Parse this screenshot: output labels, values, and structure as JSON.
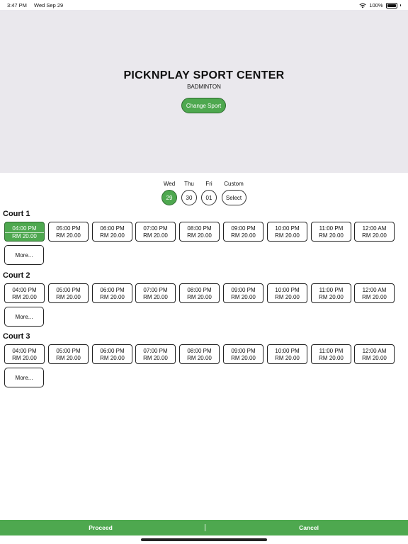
{
  "status_bar": {
    "time": "3:47 PM",
    "date": "Wed Sep 29",
    "battery": "100%",
    "wifi_icon": "wifi-icon",
    "battery_icon": "battery-icon"
  },
  "header": {
    "venue": "PICKNPLAY SPORT CENTER",
    "sport": "BADMINTON",
    "change_sport_label": "Change Sport"
  },
  "days": [
    {
      "label": "Wed",
      "value": "29",
      "selected": true
    },
    {
      "label": "Thu",
      "value": "30",
      "selected": false
    },
    {
      "label": "Fri",
      "value": "01",
      "selected": false
    },
    {
      "label": "Custom",
      "value": "Select",
      "selected": false
    }
  ],
  "courts": [
    {
      "name": "Court 1",
      "more_label": "More...",
      "selected_slot": 0,
      "slots": [
        {
          "time": "04:00 PM",
          "price": "RM 20.00"
        },
        {
          "time": "05:00 PM",
          "price": "RM 20.00"
        },
        {
          "time": "06:00 PM",
          "price": "RM 20.00"
        },
        {
          "time": "07:00 PM",
          "price": "RM 20.00"
        },
        {
          "time": "08:00 PM",
          "price": "RM 20.00"
        },
        {
          "time": "09:00 PM",
          "price": "RM 20.00"
        },
        {
          "time": "10:00 PM",
          "price": "RM 20.00"
        },
        {
          "time": "11:00 PM",
          "price": "RM 20.00"
        },
        {
          "time": "12:00 AM",
          "price": "RM 20.00"
        }
      ]
    },
    {
      "name": "Court 2",
      "more_label": "More...",
      "selected_slot": -1,
      "slots": [
        {
          "time": "04:00 PM",
          "price": "RM 20.00"
        },
        {
          "time": "05:00 PM",
          "price": "RM 20.00"
        },
        {
          "time": "06:00 PM",
          "price": "RM 20.00"
        },
        {
          "time": "07:00 PM",
          "price": "RM 20.00"
        },
        {
          "time": "08:00 PM",
          "price": "RM 20.00"
        },
        {
          "time": "09:00 PM",
          "price": "RM 20.00"
        },
        {
          "time": "10:00 PM",
          "price": "RM 20.00"
        },
        {
          "time": "11:00 PM",
          "price": "RM 20.00"
        },
        {
          "time": "12:00 AM",
          "price": "RM 20.00"
        }
      ]
    },
    {
      "name": "Court 3",
      "more_label": "More...",
      "selected_slot": -1,
      "slots": [
        {
          "time": "04:00 PM",
          "price": "RM 20.00"
        },
        {
          "time": "05:00 PM",
          "price": "RM 20.00"
        },
        {
          "time": "06:00 PM",
          "price": "RM 20.00"
        },
        {
          "time": "07:00 PM",
          "price": "RM 20.00"
        },
        {
          "time": "08:00 PM",
          "price": "RM 20.00"
        },
        {
          "time": "09:00 PM",
          "price": "RM 20.00"
        },
        {
          "time": "10:00 PM",
          "price": "RM 20.00"
        },
        {
          "time": "11:00 PM",
          "price": "RM 20.00"
        },
        {
          "time": "12:00 AM",
          "price": "RM 20.00"
        }
      ]
    }
  ],
  "footer": {
    "proceed_label": "Proceed",
    "separator": "|",
    "cancel_label": "Cancel"
  },
  "colors": {
    "accent": "#4ea84f",
    "header_bg": "#eae8ed"
  }
}
